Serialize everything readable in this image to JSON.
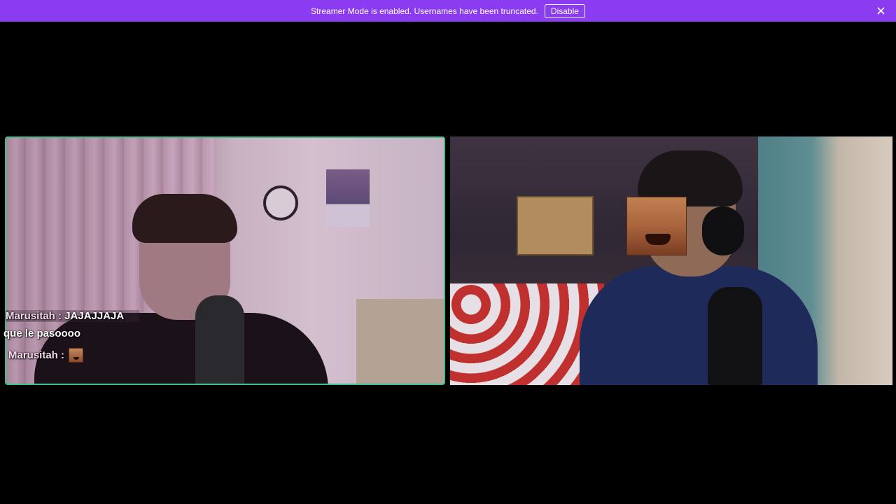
{
  "banner": {
    "message": "Streamer Mode is enabled. Usernames have been truncated.",
    "disable_label": "Disable",
    "close_icon": "close-icon",
    "color": "#8c3cf0"
  },
  "tiles": {
    "left": {
      "active_border_color": "#3ec08a"
    },
    "right": {}
  },
  "chat": {
    "line1_user": "Marusitah :",
    "line1_text": "JAJAJJAJA",
    "line2_text": "que le pasoooo",
    "line3_user": "Marusitah :",
    "line3_emote": "laughing-face-emote"
  }
}
